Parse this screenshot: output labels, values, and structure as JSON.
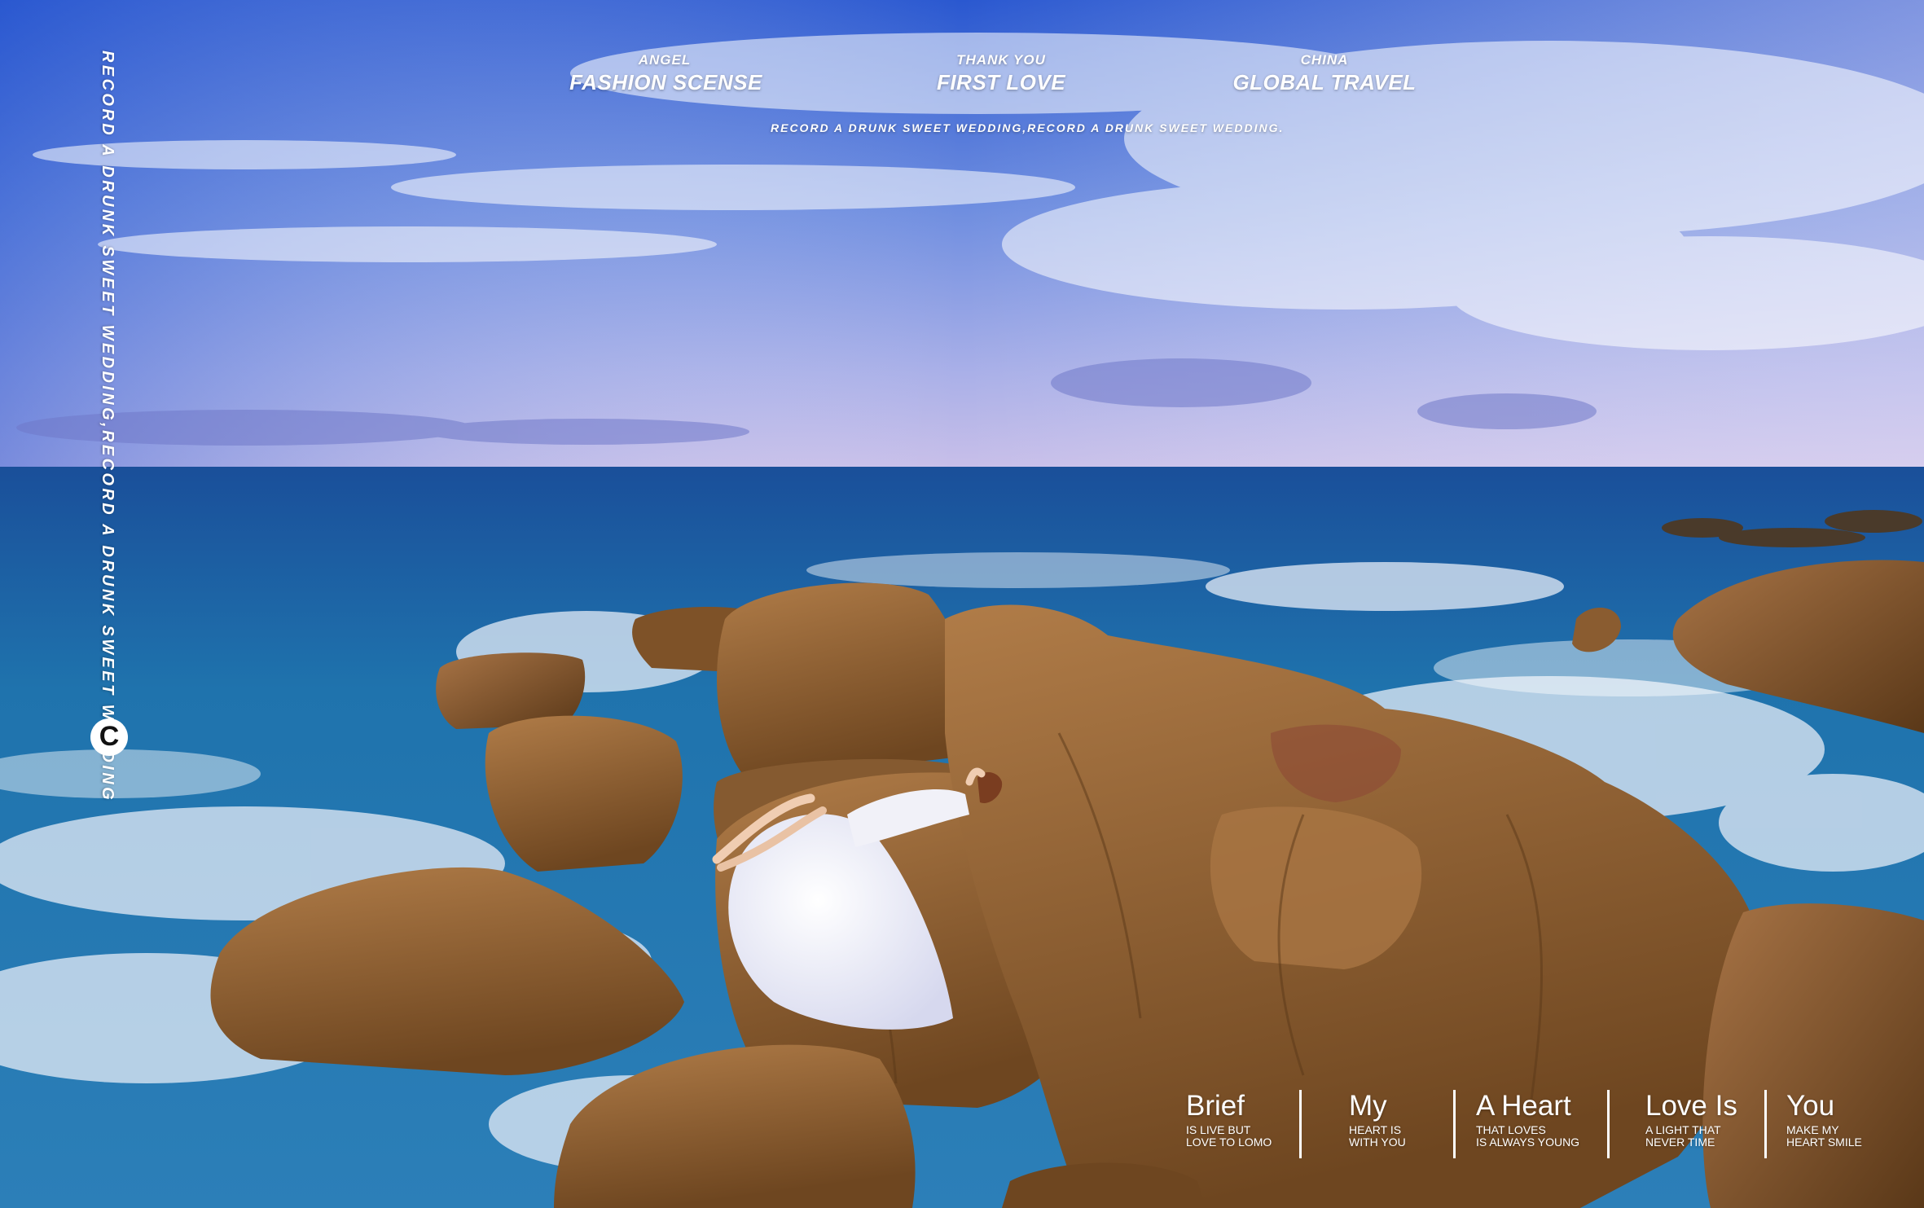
{
  "header": {
    "col1": {
      "small": "ANGEL",
      "big": "FASHION SCENSE"
    },
    "col2": {
      "small": "THANK YOU",
      "big": "FIRST LOVE"
    },
    "col3": {
      "small": "CHINA",
      "big": "GLOBAL TRAVEL"
    },
    "tagline": "RECORD A DRUNK SWEET WEDDING,RECORD A DRUNK SWEET WEDDING."
  },
  "side": {
    "vertical_text": "RECORD A DRUNK SWEET WEDDING,RECORD A DRUNK SWEET WEDDING",
    "logo_letter": "C"
  },
  "footer": [
    {
      "title": "Brief",
      "line1": "IS LIVE BUT",
      "line2": "LOVE TO LOMO"
    },
    {
      "title": "My",
      "line1": "HEART IS",
      "line2": "WITH YOU"
    },
    {
      "title": "A Heart",
      "line1": "THAT LOVES",
      "line2": "IS ALWAYS YOUNG"
    },
    {
      "title": "Love Is",
      "line1": "A LIGHT THAT",
      "line2": "NEVER TIME"
    },
    {
      "title": "You",
      "line1": "MAKE MY",
      "line2": "HEART SMILE"
    }
  ],
  "colors": {
    "sky_top": "#2f5fd6",
    "sky_horizon": "#b9b4e6",
    "sea": "#1f6fa8",
    "rock": "#9a6a3a",
    "text": "#ffffff"
  }
}
